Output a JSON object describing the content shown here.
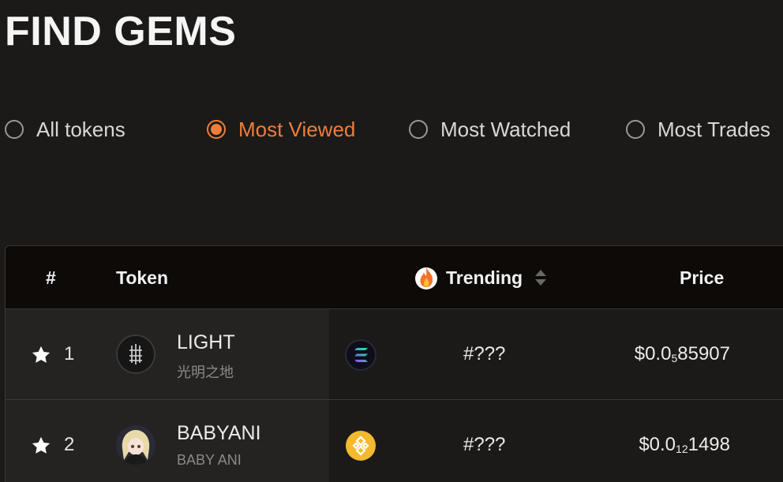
{
  "page": {
    "title": "FIND GEMS"
  },
  "filters": [
    {
      "label": "All tokens",
      "active": false
    },
    {
      "label": "Most Viewed",
      "active": true
    },
    {
      "label": "Most Watched",
      "active": false
    },
    {
      "label": "Most Trades",
      "active": false
    }
  ],
  "colors": {
    "accent": "#ef7d3a",
    "background": "#1b1a18",
    "header_bg": "#0d0a08"
  },
  "table": {
    "headers": {
      "rank": "#",
      "token": "Token",
      "trending": "Trending",
      "price": "Price"
    },
    "rows": [
      {
        "rank": "1",
        "name": "LIGHT",
        "subtitle": "光明之地",
        "chain": "solana-icon",
        "trending": "#???",
        "price_prefix": "$0.0",
        "price_zeros": "5",
        "price_digits": "85907"
      },
      {
        "rank": "2",
        "name": "BABYANI",
        "subtitle": "BABY ANI",
        "chain": "bnb-icon",
        "trending": "#???",
        "price_prefix": "$0.0",
        "price_zeros": "12",
        "price_digits": "1498"
      }
    ]
  }
}
